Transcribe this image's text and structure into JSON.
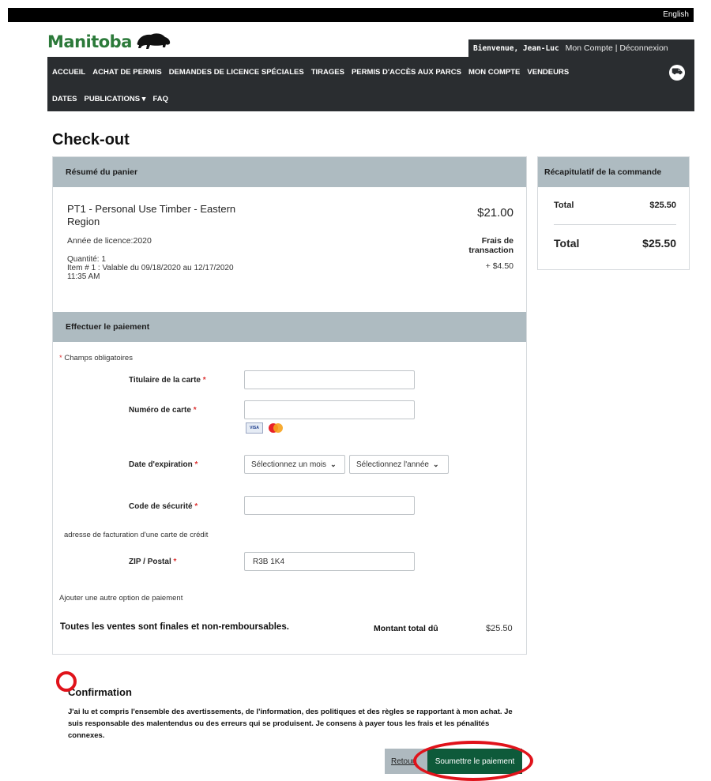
{
  "topbar": {
    "language": "English"
  },
  "brand": {
    "name": "Manitoba"
  },
  "account": {
    "welcome": "Bienvenue, Jean-Luc",
    "links": "Mon Compte | Déconnexion"
  },
  "nav": {
    "row1": [
      "ACCUEIL",
      "ACHAT DE PERMIS",
      "DEMANDES DE LICENCE SPÉCIALES",
      "TIRAGES",
      "PERMIS D'ACCÈS AUX PARCS",
      "MON COMPTE",
      "VENDEURS"
    ],
    "row2": [
      "DATES",
      "PUBLICATIONS ▾",
      "FAQ"
    ]
  },
  "page": {
    "title": "Check-out"
  },
  "cart": {
    "heading": "Résumé du panier",
    "item": {
      "name": "PT1 - Personal Use Timber - Eastern Region",
      "price": "$21.00",
      "year": "Année de licence:2020",
      "fee_label": "Frais de transaction",
      "fee_amount": "+ $4.50",
      "quantity": "Quantité: 1",
      "validity": "Item # 1 : Valable du 09/18/2020 au 12/17/2020 11:35 AM"
    }
  },
  "payment": {
    "heading": "Effectuer le paiement",
    "required_note": "Champs obligatoires",
    "cardholder_label": "Titulaire de la carte",
    "cardholder_value": "",
    "card_number_label": "Numéro de carte",
    "card_number_value": "",
    "card_brands": [
      "VISA",
      "MasterCard"
    ],
    "expiry_label": "Date d'expiration",
    "month_select": "Sélectionnez un mois",
    "year_select": "Sélectionnez l'année",
    "cvv_label": "Code de sécurité",
    "cvv_value": "",
    "billing_note": "adresse de facturation d'une carte de crédit",
    "zip_label": "ZIP / Postal",
    "zip_value": "R3B 1K4",
    "add_payment": "Ajouter une autre option de paiement",
    "final_sale": "Toutes les ventes sont finales et non-remboursables.",
    "total_due_label": "Montant total dû",
    "total_due_amount": "$25.50"
  },
  "summary": {
    "heading": "Récapitulatif de la commande",
    "total_label": "Total",
    "total_value": "$25.50",
    "grand_total_label": "Total",
    "grand_total_value": "$25.50"
  },
  "confirmation": {
    "title": "Confirmation",
    "text": "J'ai lu et compris l'ensemble des avertissements, de l'information, des politiques et des règles se rapportant à mon achat. Je suis responsable des malentendus ou des erreurs qui se produisent. Je consens à payer tous les frais et les pénalités connexes."
  },
  "buttons": {
    "back": "Retour",
    "submit": "Soumettre le paiement"
  },
  "colors": {
    "nav_bg": "#2a2d30",
    "panel_head": "#aebbc1",
    "submit_bg": "#0e5a3a",
    "annotation": "#e0131b",
    "brand_green": "#2c7a3a"
  }
}
